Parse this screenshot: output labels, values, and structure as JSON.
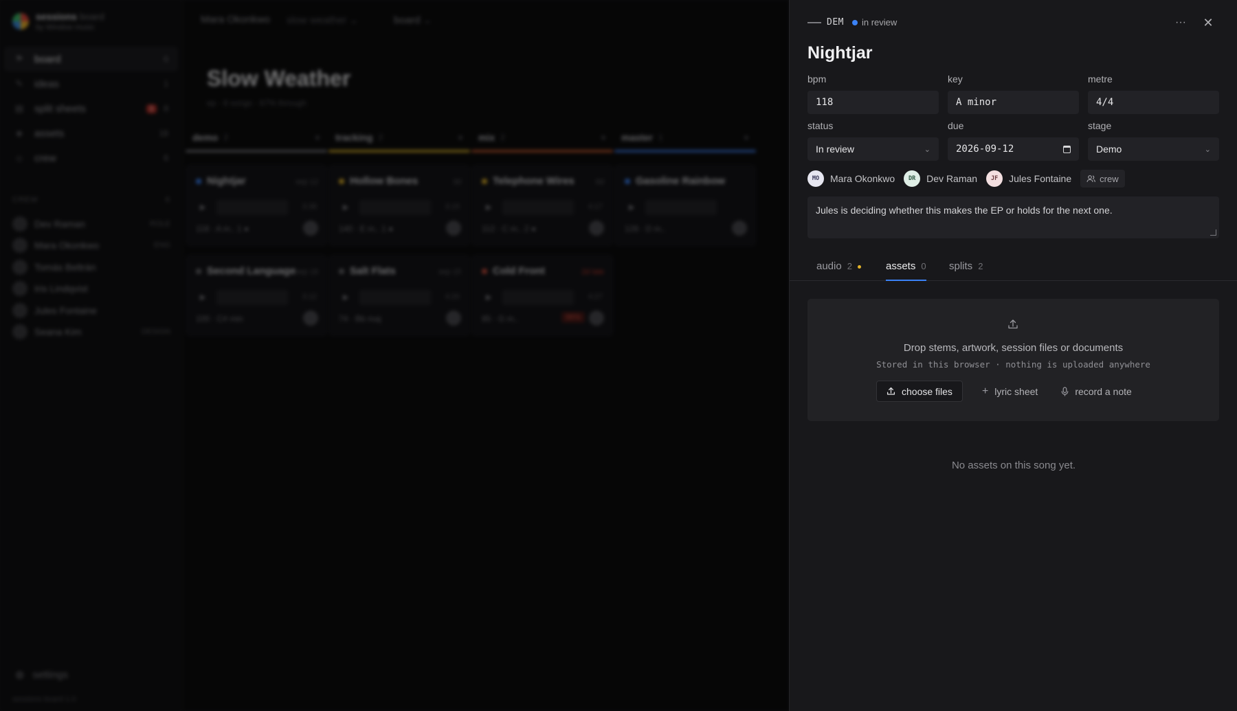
{
  "background": {
    "brand": {
      "title": "sessions",
      "title_suffix": "board",
      "subtitle": "by Window music"
    },
    "nav": [
      {
        "label": "board",
        "count": "6",
        "icon": "flag-icon",
        "active": true
      },
      {
        "label": "ideas",
        "count": "1",
        "icon": "pencil-icon"
      },
      {
        "label": "split sheets",
        "count": "8",
        "badge": "1",
        "icon": "document-icon"
      },
      {
        "label": "assets",
        "count": "16",
        "icon": "layers-icon"
      },
      {
        "label": "crew",
        "count": "6",
        "icon": "user-icon"
      }
    ],
    "crew_heading": "CREW",
    "crew_count": "6",
    "crew": [
      {
        "name": "Dev Raman",
        "tag": "ROLE"
      },
      {
        "name": "Mara Okonkwo",
        "tag": "ENG"
      },
      {
        "name": "Tomás Beltrán",
        "tag": ""
      },
      {
        "name": "Iris Lindqvist",
        "tag": ""
      },
      {
        "name": "Jules Fontaine",
        "tag": ""
      },
      {
        "name": "Seana Kim",
        "tag": "DESIGN"
      }
    ],
    "settings_label": "settings",
    "version": "sessions board 1.0",
    "breadcrumb": {
      "owner": "Mara Okonkwo",
      "project": "slow weather",
      "view": "board"
    },
    "page_title": "Slow Weather",
    "page_meta": "ep · 8 songs · 67% through",
    "columns": [
      {
        "name": "demo",
        "count": "2",
        "color": "#6b6b70",
        "cards": [
          {
            "title": "Nightjar",
            "dot": "#3b82f6",
            "meta": "sep 12",
            "dur": "3:38",
            "info": "118 · A m..",
            "extra": "1 ●"
          },
          {
            "title": "Second Language",
            "dot": "#6b6b70",
            "meta": "sep 18",
            "dur": "3:12",
            "info": "100 · C# min",
            "extra": ""
          }
        ]
      },
      {
        "name": "tracking",
        "count": "2",
        "color": "#c9a227",
        "cards": [
          {
            "title": "Hollow Bones",
            "dot": "#e4b429",
            "meta": "3d",
            "dur": "3:15",
            "info": "140 · E m..",
            "extra": "1 ●"
          },
          {
            "title": "Salt Flats",
            "dot": "#6b6b70",
            "meta": "sep 15",
            "dur": "4:20",
            "info": "74 · Bb maj",
            "extra": ""
          }
        ]
      },
      {
        "name": "mix",
        "count": "2",
        "color": "#b8532b",
        "cards": [
          {
            "title": "Telephone Wires",
            "dot": "#e4b429",
            "meta": "6d",
            "dur": "4:17",
            "info": "112 · C m..",
            "extra": "2 ●"
          },
          {
            "title": "Cold Front",
            "dot": "#d0503f",
            "meta": "2d late",
            "dur": "4:27",
            "info": "85 · G m..",
            "extra": "",
            "late_pill": "96%"
          }
        ]
      },
      {
        "name": "master",
        "count": "1",
        "color": "#3b6fd0",
        "cards": [
          {
            "title": "Gasoline Rainbow",
            "dot": "#3b82f6",
            "meta": "",
            "dur": "",
            "info": "128 · D m..",
            "extra": ""
          }
        ]
      }
    ]
  },
  "drawer": {
    "code": "DEM",
    "status_label": "in review",
    "status_color": "#3b82f6",
    "title": "Nightjar",
    "fields": {
      "bpm": {
        "label": "bpm",
        "value": "118"
      },
      "key": {
        "label": "key",
        "value": "A minor"
      },
      "metre": {
        "label": "metre",
        "value": "4/4"
      },
      "status": {
        "label": "status",
        "value": "In review"
      },
      "due": {
        "label": "due",
        "value": "2026-09-12"
      },
      "stage": {
        "label": "stage",
        "value": "Demo"
      }
    },
    "people": [
      {
        "initials": "MO",
        "name": "Mara Okonkwo",
        "bg": "#e6e6f0",
        "fg": "#3a3a5a"
      },
      {
        "initials": "DR",
        "name": "Dev Raman",
        "bg": "#dfeee6",
        "fg": "#2f5a44"
      },
      {
        "initials": "JF",
        "name": "Jules Fontaine",
        "bg": "#f3dfe0",
        "fg": "#6a3a3e"
      }
    ],
    "crew_button": "crew",
    "notes": "Jules is deciding whether this makes the EP or holds for the next one.",
    "tabs": [
      {
        "label": "audio",
        "count": "2",
        "dot": true
      },
      {
        "label": "assets",
        "count": "0",
        "active": true
      },
      {
        "label": "splits",
        "count": "2"
      }
    ],
    "dropzone": {
      "main": "Drop stems, artwork, session files or documents",
      "sub": "Stored in this browser · nothing is uploaded anywhere",
      "choose_files": "choose files",
      "lyric_sheet": "lyric sheet",
      "record_note": "record a note"
    },
    "empty_state": "No assets on this song yet."
  }
}
